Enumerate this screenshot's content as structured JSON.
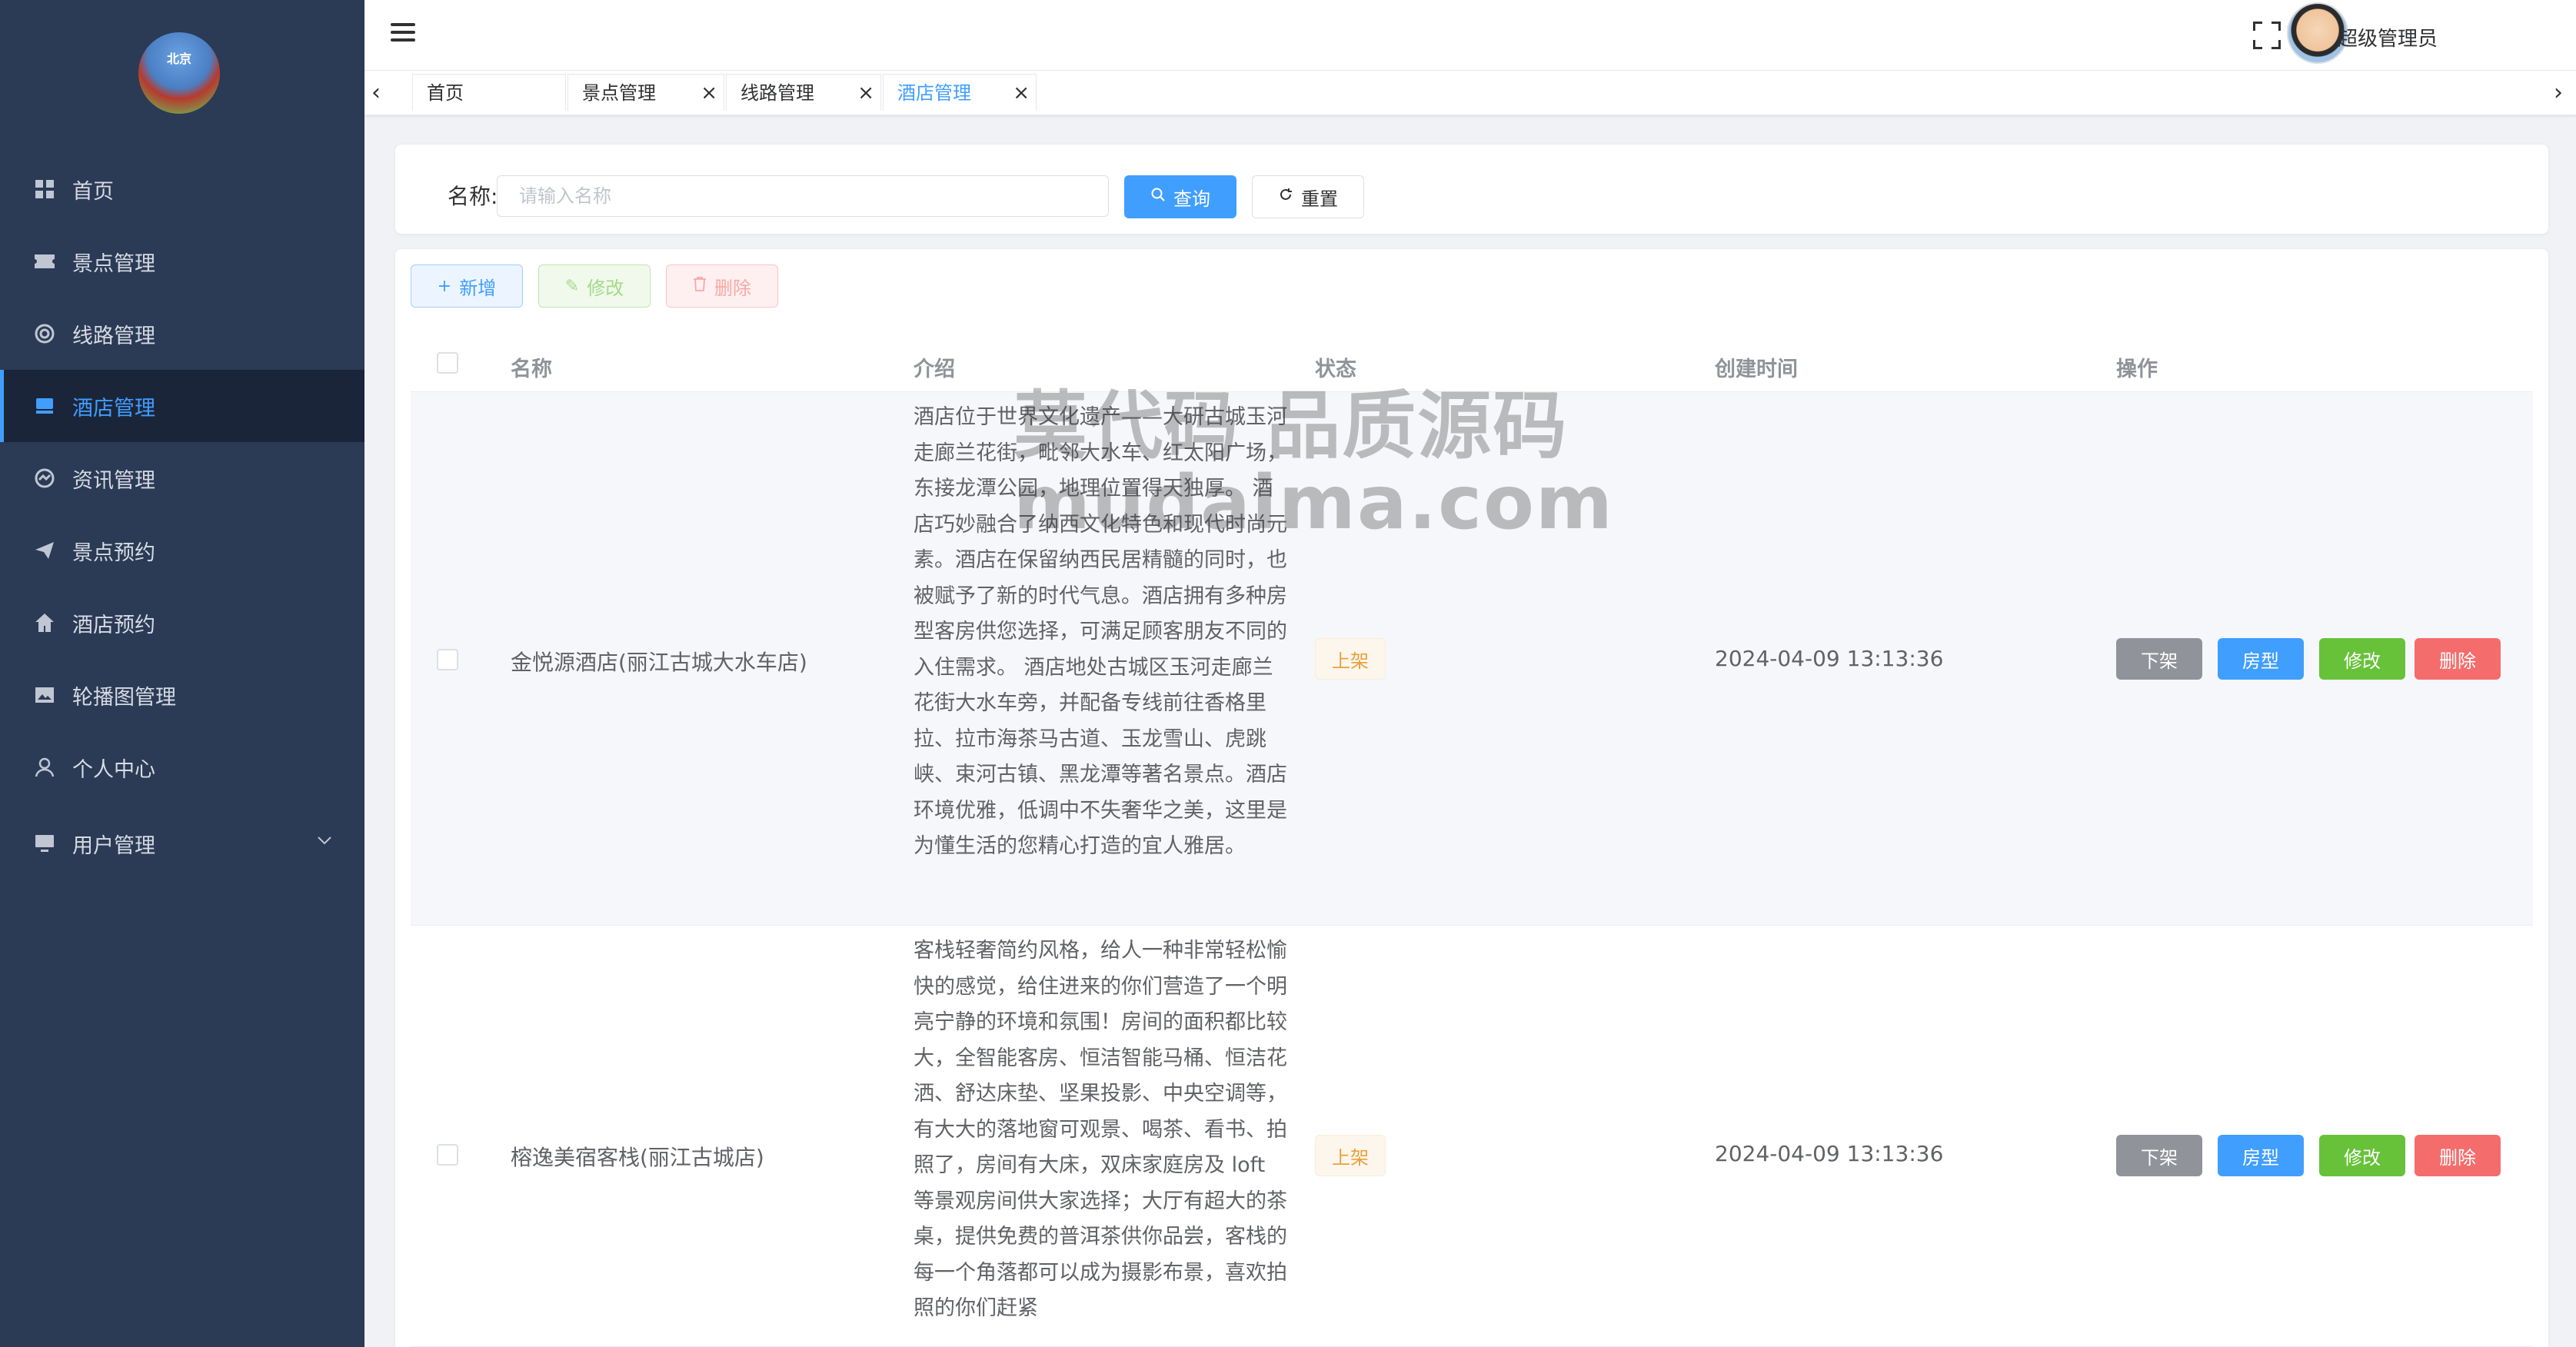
{
  "logo_text": "北京",
  "sidebar": {
    "items": [
      {
        "label": "首页",
        "icon": "dashboard-icon"
      },
      {
        "label": "景点管理",
        "icon": "ticket-icon"
      },
      {
        "label": "线路管理",
        "icon": "route-icon"
      },
      {
        "label": "酒店管理",
        "icon": "hotel-icon",
        "active": true
      },
      {
        "label": "资讯管理",
        "icon": "news-icon"
      },
      {
        "label": "景点预约",
        "icon": "send-icon"
      },
      {
        "label": "酒店预约",
        "icon": "home-icon"
      },
      {
        "label": "轮播图管理",
        "icon": "image-icon"
      },
      {
        "label": "个人中心",
        "icon": "user-icon"
      },
      {
        "label": "用户管理",
        "icon": "monitor-icon",
        "has_submenu": true
      }
    ]
  },
  "header": {
    "username": "超级管理员"
  },
  "tabs": [
    {
      "label": "首页"
    },
    {
      "label": "景点管理",
      "closable": true
    },
    {
      "label": "线路管理",
      "closable": true
    },
    {
      "label": "酒店管理",
      "closable": true,
      "active": true
    }
  ],
  "search": {
    "label": "名称:",
    "placeholder": "请输入名称",
    "query_label": "查询",
    "reset_label": "重置"
  },
  "toolbar": {
    "add_label": "新增",
    "edit_label": "修改",
    "delete_label": "删除"
  },
  "table": {
    "columns": [
      "名称",
      "介绍",
      "状态",
      "创建时间",
      "操作"
    ],
    "rows": [
      {
        "name": "金悦源酒店(丽江古城大水车店)",
        "intro": "酒店位于世界文化遗产——大研古城玉河走廊兰花街，毗邻大水车、红太阳广场，东接龙潭公园，地理位置得天独厚。 酒店巧妙融合了纳西文化特色和现代时尚元素。酒店在保留纳西民居精髓的同时，也被赋予了新的时代气息。酒店拥有多种房型客房供您选择，可满足顾客朋友不同的入住需求。 酒店地处古城区玉河走廊兰花街大水车旁，并配备专线前往香格里拉、拉市海茶马古道、玉龙雪山、虎跳峡、束河古镇、黑龙潭等著名景点。酒店环境优雅，低调中不失奢华之美，这里是为懂生活的您精心打造的宜人雅居。",
        "status": "上架",
        "created": "2024-04-09 13:13:36"
      },
      {
        "name": "榕逸美宿客栈(丽江古城店)",
        "intro": "客栈轻奢简约风格，给人一种非常轻松愉快的感觉，给住进来的你们营造了一个明亮宁静的环境和氛围！房间的面积都比较大，全智能客房、恒洁智能马桶、恒洁花洒、舒达床垫、坚果投影、中央空调等，有大大的落地窗可观景、喝茶、看书、拍照了，房间有大床，双床家庭房及 loft 等景观房间供大家选择；大厅有超大的茶桌，提供免费的普洱茶供你品尝，客栈的每一个角落都可以成为摄影布景，喜欢拍照的你们赶紧",
        "status": "上架",
        "created": "2024-04-09 13:13:36"
      }
    ],
    "actions": {
      "off_label": "下架",
      "room_label": "房型",
      "edit_label": "修改",
      "delete_label": "删除"
    }
  },
  "watermark": {
    "line1": "莫代码 品质源码",
    "line2": "mudaima.com"
  },
  "colors": {
    "primary": "#409eff",
    "sidebar_bg": "#2b3a55",
    "success": "#67c23a",
    "danger": "#f56c6c",
    "info": "#909399",
    "warning": "#e6a23c"
  }
}
